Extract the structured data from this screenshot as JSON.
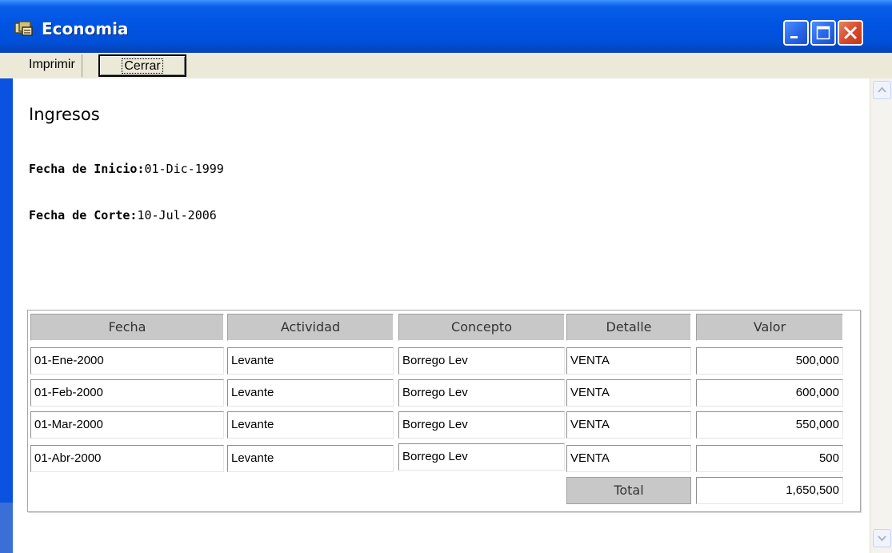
{
  "window": {
    "title": "Economia"
  },
  "menu": {
    "imprimir": "Imprimir",
    "cerrar": "Cerrar"
  },
  "page": {
    "title": "Ingresos",
    "inicio_label": "Fecha de Inicio:",
    "inicio_value": "01-Dic-1999",
    "corte_label": "Fecha de Corte:",
    "corte_value": "10-Jul-2006"
  },
  "table": {
    "headers": [
      "Fecha",
      "Actividad",
      "Concepto",
      "Detalle",
      "Valor"
    ],
    "rows": [
      {
        "fecha": "01-Ene-2000",
        "actividad": "Levante",
        "concepto": "Borrego Lev",
        "detalle": "VENTA",
        "valor": "500,000"
      },
      {
        "fecha": "01-Feb-2000",
        "actividad": "Levante",
        "concepto": "Borrego Lev",
        "detalle": "VENTA",
        "valor": "600,000"
      },
      {
        "fecha": "01-Mar-2000",
        "actividad": "Levante",
        "concepto": "Borrego Lev",
        "detalle": "VENTA",
        "valor": "550,000"
      },
      {
        "fecha": "01-Abr-2000",
        "actividad": "Levante",
        "concepto": "Borrego Lev",
        "detalle": "VENTA",
        "valor": "500"
      }
    ],
    "total_label": "Total",
    "total_value": "1,650,500"
  },
  "icons": {
    "app": "app-icon",
    "minimize": "minimize-icon",
    "maximize": "maximize-icon",
    "close": "close-icon",
    "scroll_up": "scroll-up-icon",
    "scroll_down": "scroll-down-icon"
  }
}
